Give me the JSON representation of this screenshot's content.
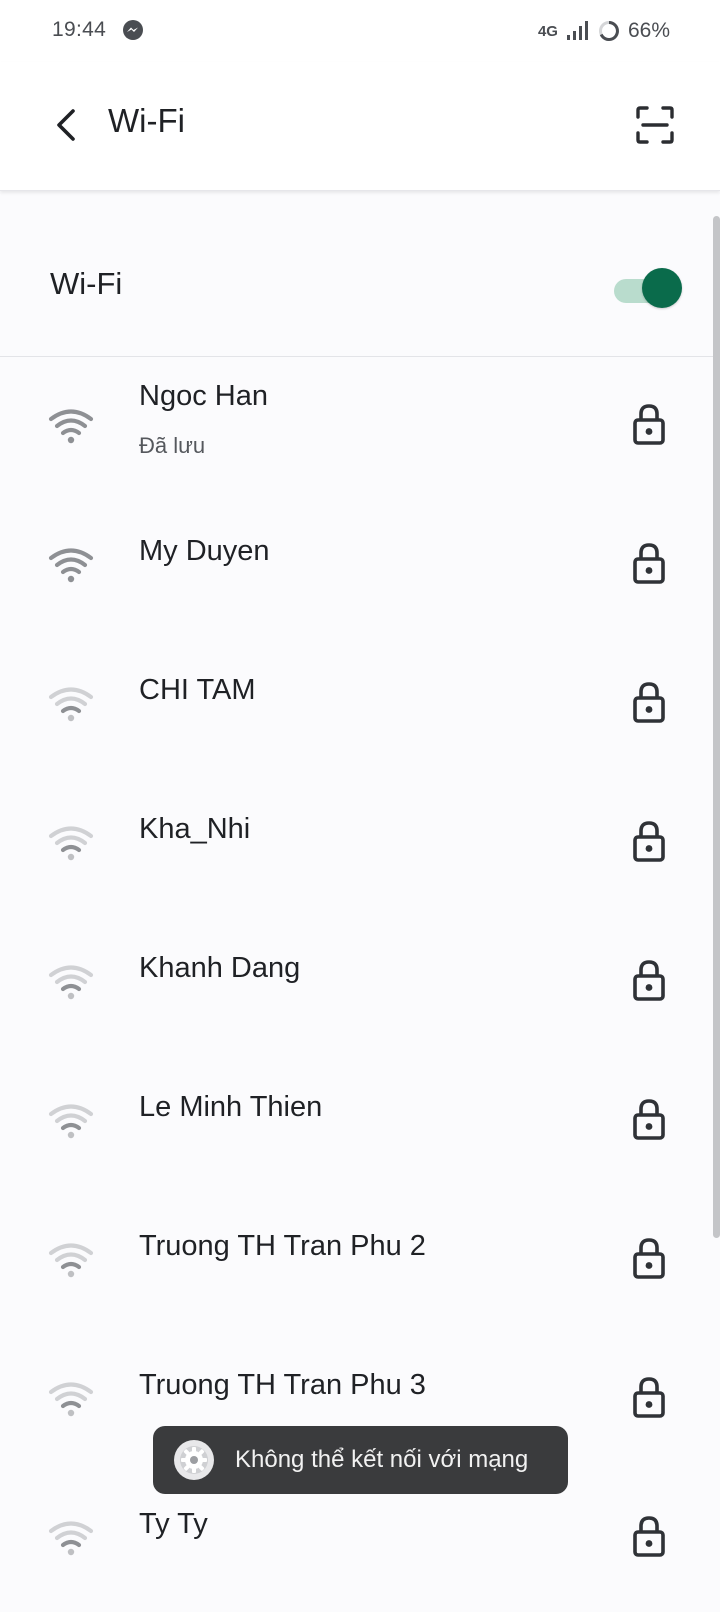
{
  "status_bar": {
    "time": "19:44",
    "network_type": "4G",
    "battery_percent": "66%",
    "icons": [
      "messenger-icon",
      "signal-icon",
      "battery-icon"
    ]
  },
  "header": {
    "title": "Wi-Fi",
    "back_icon": "back-arrow-icon",
    "scan_icon": "qr-scan-icon"
  },
  "wifi_toggle": {
    "label": "Wi-Fi",
    "enabled": true,
    "accent_color": "#0a6b4b",
    "track_color": "#b9dccd"
  },
  "networks": [
    {
      "name": "Ngoc Han",
      "status": "Đã lưu",
      "signal": 3,
      "secured": true
    },
    {
      "name": "My Duyen",
      "status": "",
      "signal": 3,
      "secured": true
    },
    {
      "name": "CHI TAM",
      "status": "",
      "signal": 1,
      "secured": true
    },
    {
      "name": "Kha_Nhi",
      "status": "",
      "signal": 1,
      "secured": true
    },
    {
      "name": "Khanh Dang",
      "status": "",
      "signal": 1,
      "secured": true
    },
    {
      "name": "Le Minh Thien",
      "status": "",
      "signal": 1,
      "secured": true
    },
    {
      "name": "Truong TH Tran Phu 2",
      "status": "",
      "signal": 1,
      "secured": true
    },
    {
      "name": "Truong TH Tran Phu 3",
      "status": "",
      "signal": 1,
      "secured": true
    },
    {
      "name": "Ty Ty",
      "status": "",
      "signal": 1,
      "secured": true
    }
  ],
  "toast": {
    "message": "Không thể kết nối với mạng",
    "icon": "settings-gear-icon"
  }
}
